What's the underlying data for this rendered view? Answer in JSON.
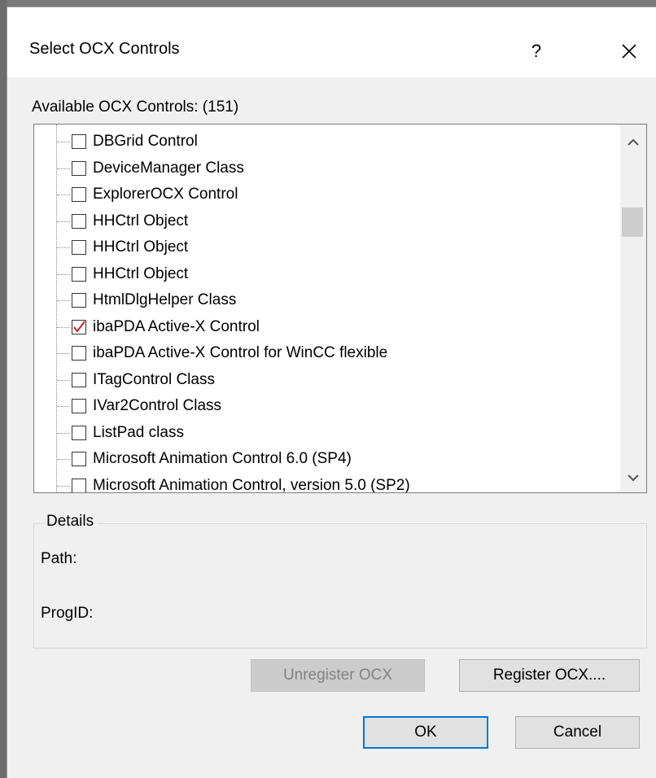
{
  "window": {
    "title": "Select OCX Controls",
    "help_glyph": "?",
    "close_icon": "close-icon"
  },
  "available": {
    "label": "Available OCX Controls: (151)",
    "items": [
      {
        "label": "DBGrid  Control",
        "checked": false
      },
      {
        "label": "DeviceManager Class",
        "checked": false
      },
      {
        "label": "ExplorerOCX Control",
        "checked": false
      },
      {
        "label": "HHCtrl Object",
        "checked": false
      },
      {
        "label": "HHCtrl Object",
        "checked": false
      },
      {
        "label": "HHCtrl Object",
        "checked": false
      },
      {
        "label": "HtmlDlgHelper Class",
        "checked": false
      },
      {
        "label": "ibaPDA Active-X Control",
        "checked": true
      },
      {
        "label": "ibaPDA Active-X Control for WinCC flexible",
        "checked": false
      },
      {
        "label": "ITagControl Class",
        "checked": false
      },
      {
        "label": "IVar2Control Class",
        "checked": false
      },
      {
        "label": "ListPad class",
        "checked": false
      },
      {
        "label": "Microsoft Animation Control 6.0 (SP4)",
        "checked": false
      },
      {
        "label": "Microsoft Animation Control, version 5.0 (SP2)",
        "checked": false
      }
    ],
    "check_color": "#d11f1f",
    "scroll_up_icon": "chevron-up-icon",
    "scroll_down_icon": "chevron-down-icon"
  },
  "details": {
    "legend": "Details",
    "path_label": "Path:",
    "progid_label": "ProgID:"
  },
  "buttons": {
    "unregister": "Unregister OCX",
    "register": "Register OCX....",
    "ok": "OK",
    "cancel": "Cancel"
  },
  "colors": {
    "accent": "#0078d7",
    "dialog_bg": "#f0f0f0"
  }
}
